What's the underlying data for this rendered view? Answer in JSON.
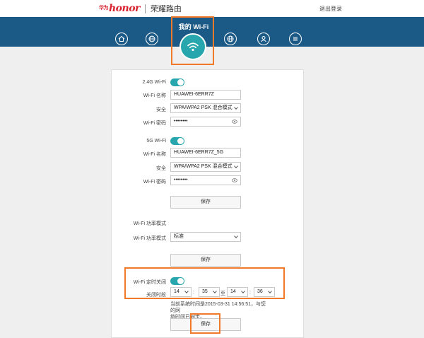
{
  "header": {
    "brand_prefix": "华为",
    "brand_logo": "honor",
    "brand_name": "荣耀路由",
    "logout_label": "退出登录"
  },
  "nav": {
    "items": [
      {
        "icon": "home-icon"
      },
      {
        "icon": "globe-icon"
      },
      {
        "icon": "wifi-icon",
        "label": "我的 Wi-Fi",
        "active": true
      },
      {
        "icon": "globe-icon"
      },
      {
        "icon": "user-icon"
      },
      {
        "icon": "menu-icon"
      }
    ]
  },
  "wifi24": {
    "toggle_label": "2.4G Wi-Fi",
    "enabled": true,
    "name_label": "Wi-Fi 名称",
    "name_value": "HUAWEI-6ERR7Z",
    "security_label": "安全",
    "security_value": "WPA/WPA2 PSK 混合模式",
    "password_label": "Wi-Fi 密码",
    "password_value": "••••••••"
  },
  "wifi5": {
    "toggle_label": "5G Wi-Fi",
    "enabled": true,
    "name_label": "Wi-Fi 名称",
    "name_value": "HUAWEI-6ERR7Z_5G",
    "security_label": "安全",
    "security_value": "WPA/WPA2 PSK 混合模式",
    "password_label": "Wi-Fi 密码",
    "password_value": "••••••••"
  },
  "save_label": "保存",
  "power": {
    "section_label": "Wi-Fi 功率模式",
    "mode_label": "Wi-Fi 功率模式",
    "mode_value": "标准"
  },
  "timer": {
    "toggle_label": "Wi-Fi 定时关闭",
    "enabled": true,
    "time_label": "关闭时段",
    "start_hour": "14",
    "start_min": "35",
    "to_label": "至",
    "end_hour": "14",
    "end_min": "36",
    "colon": ":",
    "note_line1": "当前系统时间是2015-03-31 14:56:51，与您的网",
    "note_line2": "络时间已同步。"
  },
  "colors": {
    "accent": "#27a7ad",
    "navband": "#1b5a86",
    "highlight": "#f07a2a",
    "brand": "#d9232e"
  }
}
